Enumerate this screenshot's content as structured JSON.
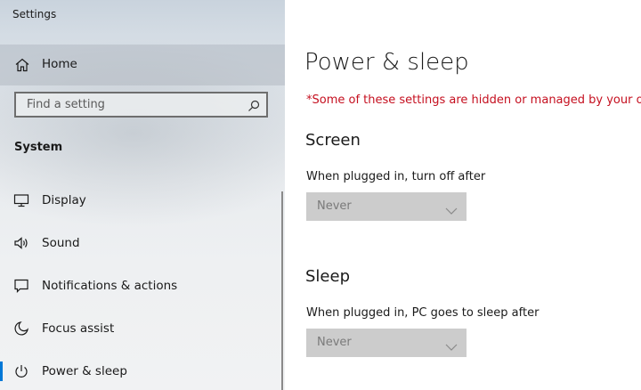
{
  "app": {
    "title": "Settings"
  },
  "sidebar": {
    "home_label": "Home",
    "search": {
      "placeholder": "Find a setting",
      "value": ""
    },
    "section_title": "System",
    "items": [
      {
        "label": "Display",
        "icon": "monitor-icon"
      },
      {
        "label": "Sound",
        "icon": "speaker-icon"
      },
      {
        "label": "Notifications & actions",
        "icon": "notification-icon"
      },
      {
        "label": "Focus assist",
        "icon": "moon-icon"
      },
      {
        "label": "Power & sleep",
        "icon": "power-icon",
        "selected": true
      }
    ]
  },
  "main": {
    "title": "Power & sleep",
    "warning": "*Some of these settings are hidden or managed by your organization.",
    "screen": {
      "heading": "Screen",
      "label": "When plugged in, turn off after",
      "value": "Never"
    },
    "sleep": {
      "heading": "Sleep",
      "label": "When plugged in, PC goes to sleep after",
      "value": "Never"
    }
  },
  "colors": {
    "accent": "#0078d7",
    "warning": "#c50f1f",
    "dropdown_bg": "#cccccc",
    "dropdown_text": "#7a7a7a"
  }
}
